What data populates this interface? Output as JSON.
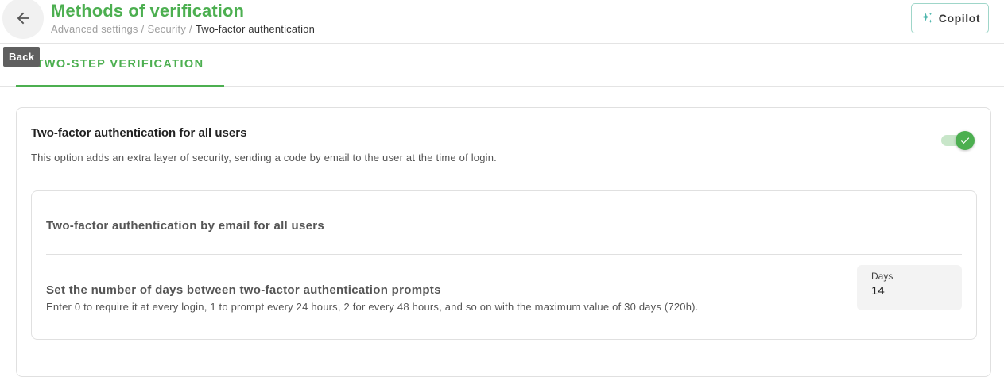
{
  "header": {
    "title": "Methods of verification",
    "back_tooltip": "Back",
    "breadcrumb": [
      "Advanced settings",
      "Security",
      "Two-factor authentication"
    ],
    "copilot_label": "Copilot"
  },
  "tabs": [
    {
      "label": "TWO-STEP VERIFICATION",
      "active": true
    }
  ],
  "settings": {
    "title": "Two-factor authentication for all users",
    "description": "This option adds an extra layer of security, sending a code by email to the user at the time of login.",
    "enabled": true,
    "email_section_title": "Two-factor authentication by email for all users",
    "days_title": "Set the number of days between two-factor authentication prompts",
    "days_description": "Enter 0 to require it at every login, 1 to prompt every 24 hours, 2 for every 48 hours, and so on with the maximum value of 30 days (720h).",
    "days_field": {
      "label": "Days",
      "value": "14"
    }
  },
  "colors": {
    "accent": "#4caf50",
    "accent_light": "#c8e6c9",
    "copilot_border": "#9fd6c9"
  },
  "icons": [
    "back-arrow-icon",
    "sparkle-icon",
    "check-icon"
  ]
}
